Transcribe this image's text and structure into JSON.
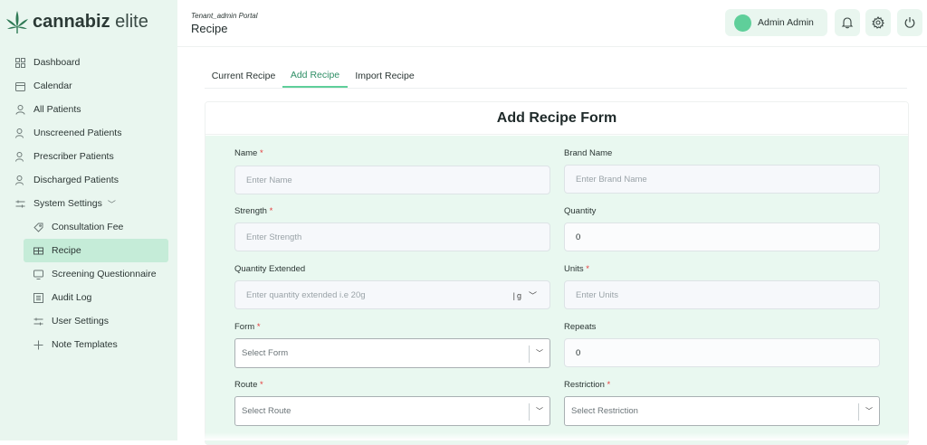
{
  "app": {
    "logo_bold": "cannabiz",
    "logo_light": " elite",
    "brand_color": "#5fcf9a"
  },
  "sidebar": {
    "items": [
      {
        "label": "Dashboard",
        "icon": "grid-icon"
      },
      {
        "label": "Calendar",
        "icon": "calendar-icon"
      },
      {
        "label": "All Patients",
        "icon": "user-icon"
      },
      {
        "label": "Unscreened Patients",
        "icon": "user-x-icon"
      },
      {
        "label": "Prescriber Patients",
        "icon": "user-check-icon"
      },
      {
        "label": "Discharged Patients",
        "icon": "user-minus-icon"
      },
      {
        "label": "System Settings",
        "icon": "sliders-icon"
      }
    ],
    "sub_items": [
      {
        "label": "Consultation Fee",
        "icon": "tag-icon"
      },
      {
        "label": "Recipe",
        "icon": "table-icon"
      },
      {
        "label": "Screening Questionnaire",
        "icon": "monitor-icon"
      },
      {
        "label": "Audit Log",
        "icon": "list-icon"
      },
      {
        "label": "User Settings",
        "icon": "sliders-icon"
      },
      {
        "label": "Note Templates",
        "icon": "plus-icon"
      }
    ]
  },
  "header": {
    "portal": "Tenant_admin Portal",
    "title": "Recipe",
    "user_name": "Admin Admin"
  },
  "tabs": [
    "Current Recipe",
    "Add Recipe",
    "Import Recipe"
  ],
  "form": {
    "title": "Add Recipe Form",
    "name": {
      "label": "Name",
      "placeholder": "Enter Name"
    },
    "brand": {
      "label": "Brand Name",
      "placeholder": "Enter Brand Name"
    },
    "strength": {
      "label": "Strength",
      "placeholder": "Enter Strength"
    },
    "quantity": {
      "label": "Quantity",
      "value": "0"
    },
    "qty_ext": {
      "label": "Quantity Extended",
      "placeholder": "Enter quantity extended i.e 20g",
      "unit": "g"
    },
    "units": {
      "label": "Units",
      "placeholder": "Enter Units"
    },
    "form_field": {
      "label": "Form",
      "placeholder": "Select Form"
    },
    "repeats": {
      "label": "Repeats",
      "value": "0"
    },
    "route": {
      "label": "Route",
      "placeholder": "Select Route"
    },
    "restriction": {
      "label": "Restriction",
      "placeholder": "Select Restriction"
    },
    "required_mark": "*"
  }
}
